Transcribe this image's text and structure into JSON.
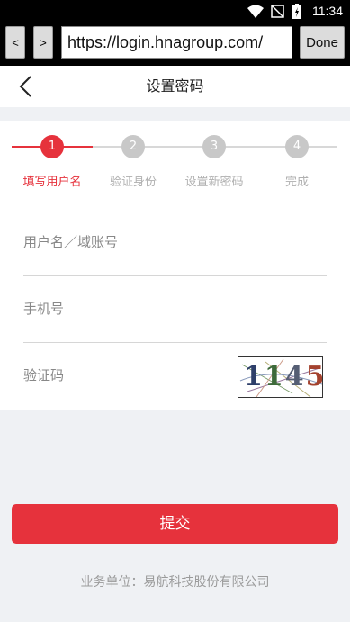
{
  "status_bar": {
    "time": "11:34",
    "icons": [
      "wifi-icon",
      "signal-off-icon",
      "battery-icon"
    ]
  },
  "browser": {
    "back_label": "<",
    "forward_label": ">",
    "url": "https://login.hnagroup.com/",
    "done_label": "Done"
  },
  "header": {
    "title": "设置密码"
  },
  "stepper": {
    "active_color": "#e6323c",
    "steps": [
      {
        "number": "1",
        "label": "填写用户名",
        "active": true
      },
      {
        "number": "2",
        "label": "验证身份",
        "active": false
      },
      {
        "number": "3",
        "label": "设置新密码",
        "active": false
      },
      {
        "number": "4",
        "label": "完成",
        "active": false
      }
    ]
  },
  "form": {
    "username_placeholder": "用户名／域账号",
    "phone_placeholder": "手机号",
    "captcha_placeholder": "验证码",
    "captcha_text": "1145"
  },
  "submit_label": "提交",
  "footer": "业务单位：易航科技股份有限公司"
}
